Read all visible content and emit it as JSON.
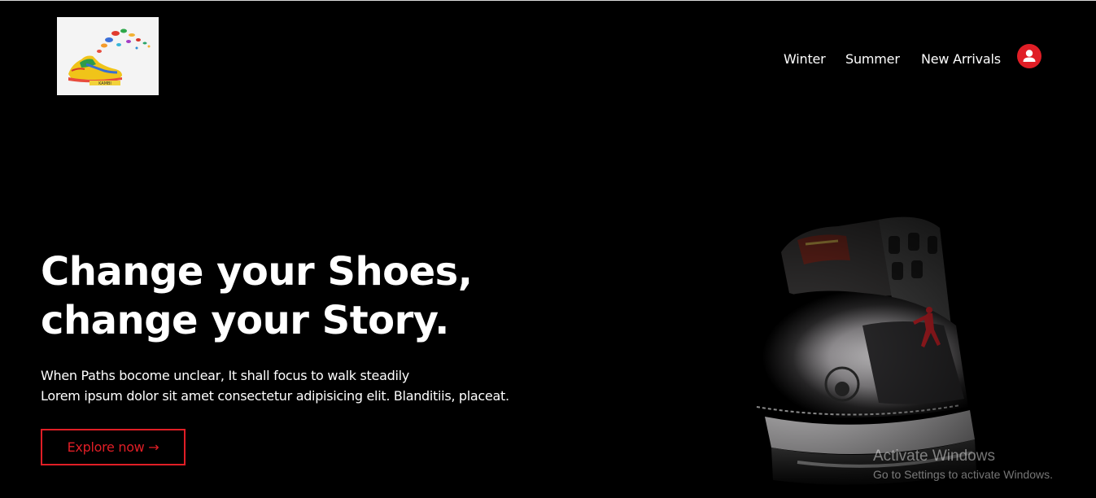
{
  "header": {
    "logo_text": "KAMBI",
    "nav": [
      {
        "label": "Winter"
      },
      {
        "label": "Summer"
      },
      {
        "label": "New Arrivals"
      }
    ],
    "accent_color": "#e01e26"
  },
  "hero": {
    "title_line1": "Change your Shoes,",
    "title_line2": "change your Story.",
    "subtitle_line1": "When Paths bocome unclear, It shall focus to walk steadily",
    "subtitle_line2": "Lorem ipsum dolor sit amet consectetur adipisicing elit. Blanditiis, placeat.",
    "cta_label": "Explore now →"
  },
  "os_watermark": {
    "line1": "Activate Windows",
    "line2": "Go to Settings to activate Windows."
  },
  "icons": {
    "user": "user-icon",
    "logo": "shoe-logo-icon",
    "hero_image": "sneaker-image"
  }
}
